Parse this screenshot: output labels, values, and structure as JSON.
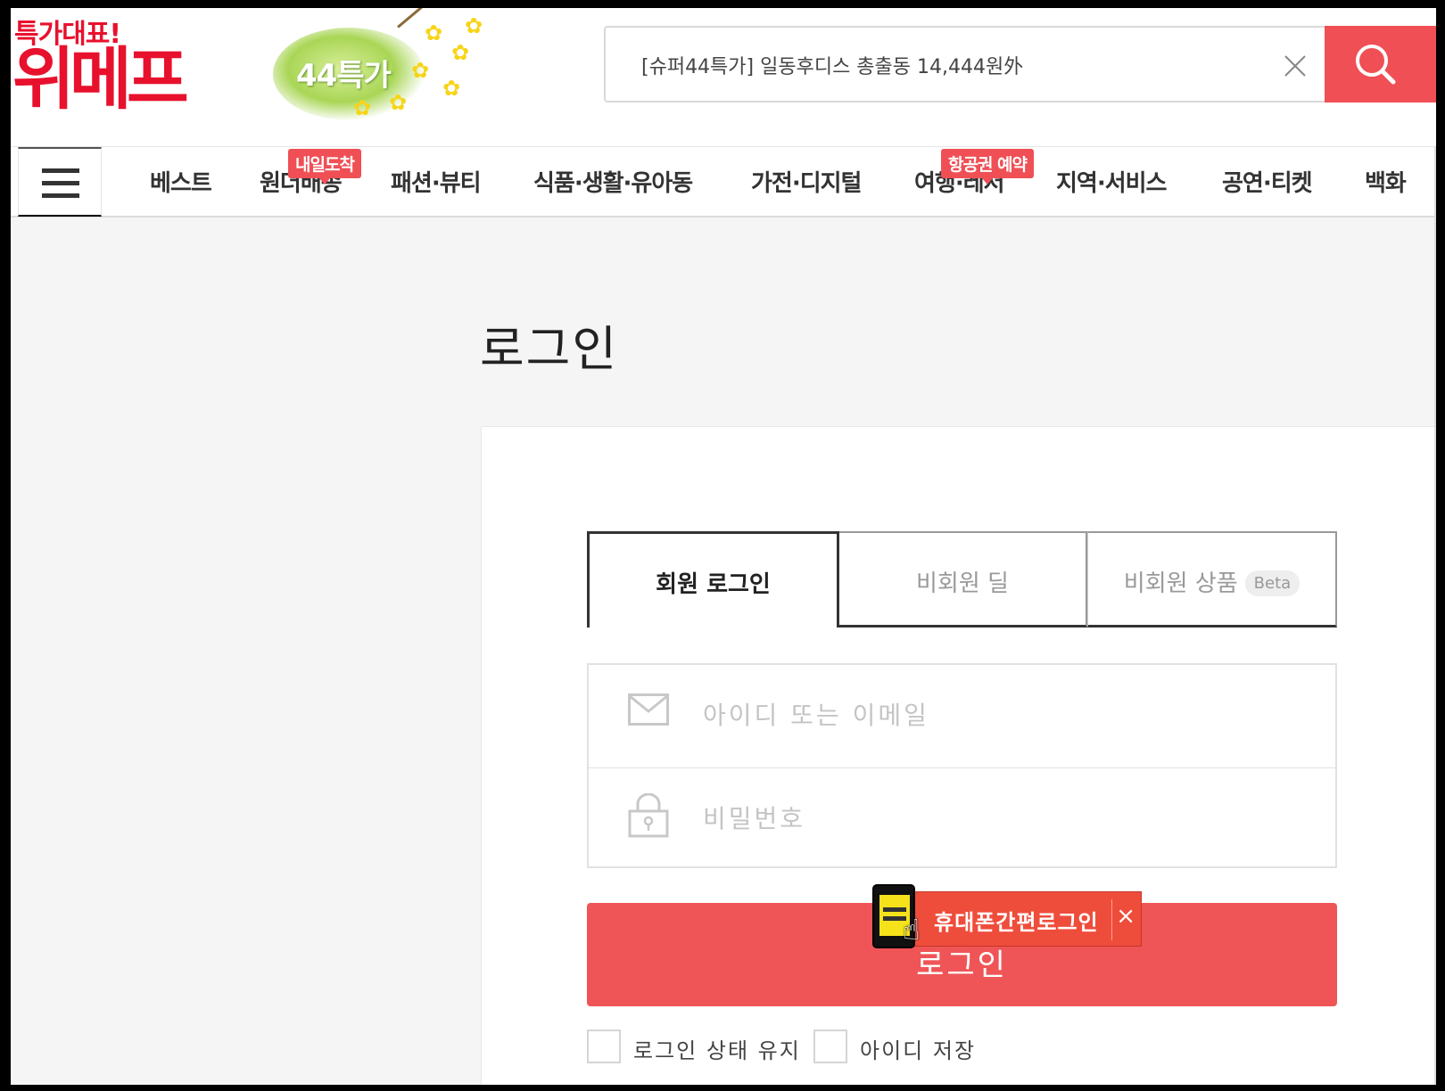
{
  "header": {
    "logo_tagline": "특가대표!",
    "logo_name": "위메프",
    "promo_label": "44특가",
    "search": {
      "value": "[슈퍼44특가] 일동후디스 총출동 14,444원外"
    }
  },
  "nav": {
    "items": [
      {
        "label": "베스트",
        "badge": null
      },
      {
        "label": "원더배송",
        "badge": "내일도착"
      },
      {
        "label": "패션·뷰티",
        "badge": null
      },
      {
        "label": "식품·생활·유아동",
        "badge": null
      },
      {
        "label": "가전·디지털",
        "badge": null
      },
      {
        "label": "여행·레저",
        "badge": "항공권 예약"
      },
      {
        "label": "지역·서비스",
        "badge": null
      },
      {
        "label": "공연·티켓",
        "badge": null
      },
      {
        "label": "백화",
        "badge": null
      }
    ]
  },
  "login": {
    "title": "로그인",
    "tabs": [
      {
        "label": "회원 로그인",
        "active": true
      },
      {
        "label": "비회원 딜",
        "active": false
      },
      {
        "label": "비회원 상품",
        "active": false,
        "tag": "Beta"
      }
    ],
    "id_placeholder": "아이디 또는 이메일",
    "pw_placeholder": "비밀번호",
    "submit_label": "로그인",
    "quick_login_label": "휴대폰간편로그인",
    "quick_login_close": "×",
    "options": [
      {
        "label": "로그인 상태 유지"
      },
      {
        "label": "아이디 저장"
      }
    ]
  },
  "colors": {
    "brand_red": "#e8112d",
    "accent": "#ef4f55",
    "quick_login_bg": "#ef4d3c"
  }
}
